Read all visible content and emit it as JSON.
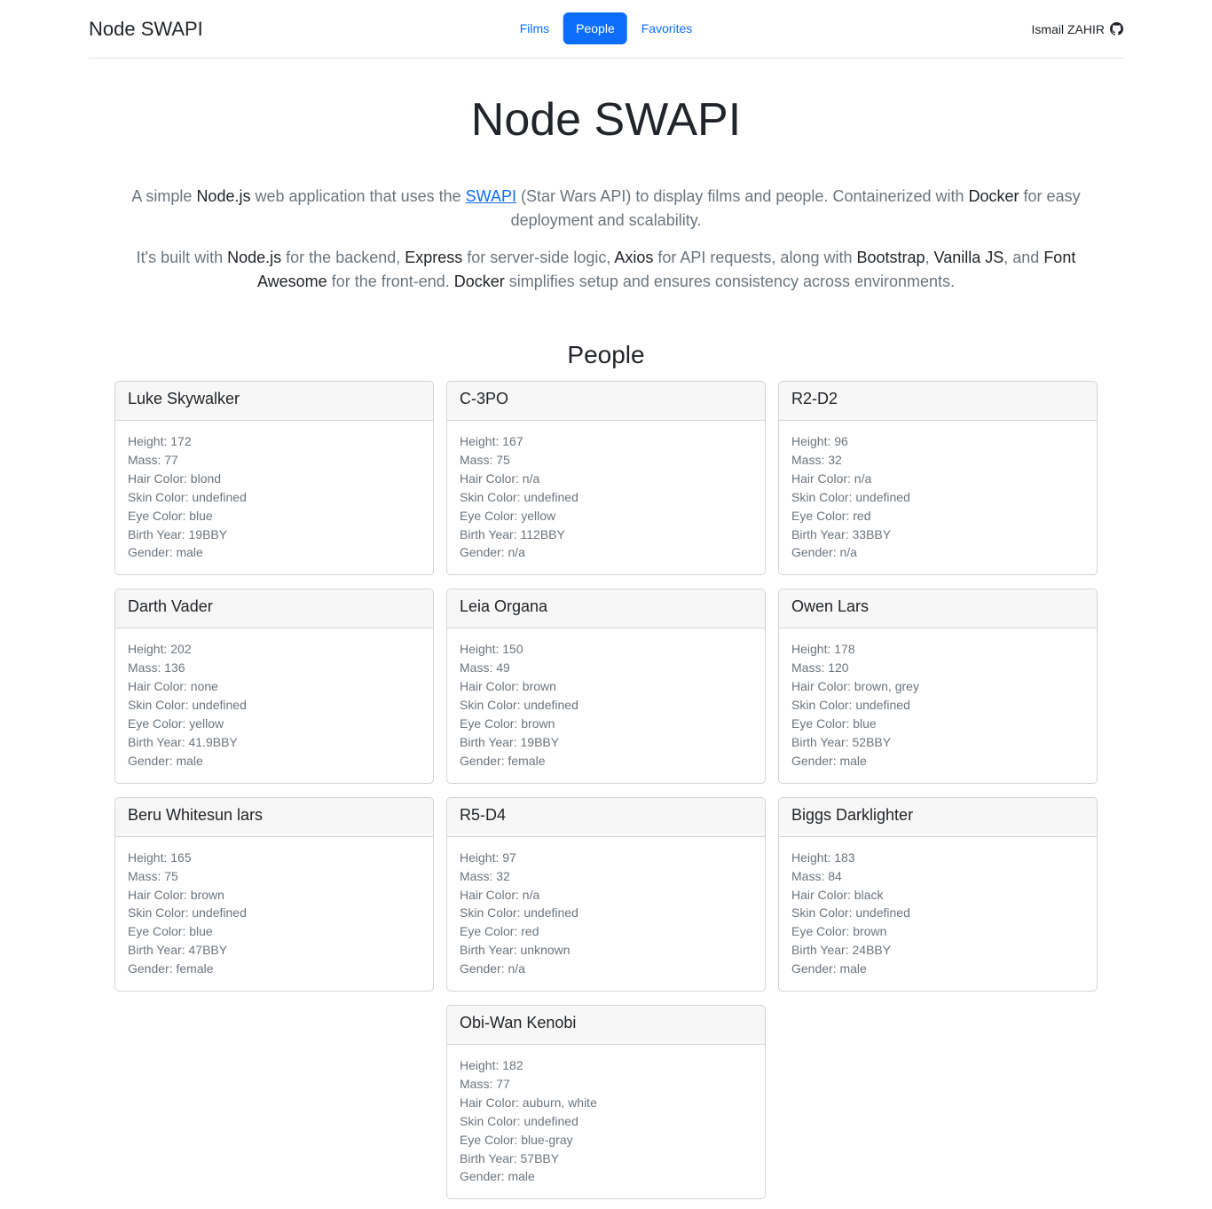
{
  "header": {
    "brand": "Node SWAPI",
    "nav": [
      {
        "label": "Films",
        "active": false
      },
      {
        "label": "People",
        "active": true
      },
      {
        "label": "Favorites",
        "active": false
      }
    ],
    "author": "Ismail ZAHIR",
    "author_icon": "github-icon"
  },
  "hero": {
    "title": "Node SWAPI",
    "lead1": {
      "t1": "A simple ",
      "nodejs": "Node.js",
      "t2": " web application that uses the ",
      "swapi": "SWAPI",
      "t3": " (Star Wars API) to display films and people. Containerized with ",
      "docker": "Docker",
      "t4": " for easy deployment and scalability."
    },
    "lead2": {
      "t1": "It's built with ",
      "nodejs": "Node.js",
      "t2": " for the backend, ",
      "express": "Express",
      "t3": " for server-side logic, ",
      "axios": "Axios",
      "t4": " for API requests, along with ",
      "bootstrap": "Bootstrap",
      "t5": ", ",
      "vanilla": "Vanilla JS",
      "t6": ", and ",
      "fontawesome": "Font Awesome",
      "t7": " for the front-end. ",
      "docker": "Docker",
      "t8": " simplifies setup and ensures consistency across environments."
    }
  },
  "section_title": "People",
  "labels": {
    "height": "Height: ",
    "mass": "Mass: ",
    "hair": "Hair Color: ",
    "skin": "Skin Color: ",
    "eye": "Eye Color: ",
    "birth": "Birth Year: ",
    "gender": "Gender: "
  },
  "people": [
    {
      "name": "Luke Skywalker",
      "height": "172",
      "mass": "77",
      "hair": "blond",
      "skin": "undefined",
      "eye": "blue",
      "birth": "19BBY",
      "gender": "male"
    },
    {
      "name": "C-3PO",
      "height": "167",
      "mass": "75",
      "hair": "n/a",
      "skin": "undefined",
      "eye": "yellow",
      "birth": "112BBY",
      "gender": "n/a"
    },
    {
      "name": "R2-D2",
      "height": "96",
      "mass": "32",
      "hair": "n/a",
      "skin": "undefined",
      "eye": "red",
      "birth": "33BBY",
      "gender": "n/a"
    },
    {
      "name": "Darth Vader",
      "height": "202",
      "mass": "136",
      "hair": "none",
      "skin": "undefined",
      "eye": "yellow",
      "birth": "41.9BBY",
      "gender": "male"
    },
    {
      "name": "Leia Organa",
      "height": "150",
      "mass": "49",
      "hair": "brown",
      "skin": "undefined",
      "eye": "brown",
      "birth": "19BBY",
      "gender": "female"
    },
    {
      "name": "Owen Lars",
      "height": "178",
      "mass": "120",
      "hair": "brown, grey",
      "skin": "undefined",
      "eye": "blue",
      "birth": "52BBY",
      "gender": "male"
    },
    {
      "name": "Beru Whitesun lars",
      "height": "165",
      "mass": "75",
      "hair": "brown",
      "skin": "undefined",
      "eye": "blue",
      "birth": "47BBY",
      "gender": "female"
    },
    {
      "name": "R5-D4",
      "height": "97",
      "mass": "32",
      "hair": "n/a",
      "skin": "undefined",
      "eye": "red",
      "birth": "unknown",
      "gender": "n/a"
    },
    {
      "name": "Biggs Darklighter",
      "height": "183",
      "mass": "84",
      "hair": "black",
      "skin": "undefined",
      "eye": "brown",
      "birth": "24BBY",
      "gender": "male"
    },
    {
      "name": "Obi-Wan Kenobi",
      "height": "182",
      "mass": "77",
      "hair": "auburn, white",
      "skin": "undefined",
      "eye": "blue-gray",
      "birth": "57BBY",
      "gender": "male"
    }
  ],
  "colors": {
    "primary": "#0d6efd",
    "muted": "#6c757d",
    "text": "#212529",
    "card_header_bg": "#f7f7f7",
    "border": "#d3d5d8"
  }
}
